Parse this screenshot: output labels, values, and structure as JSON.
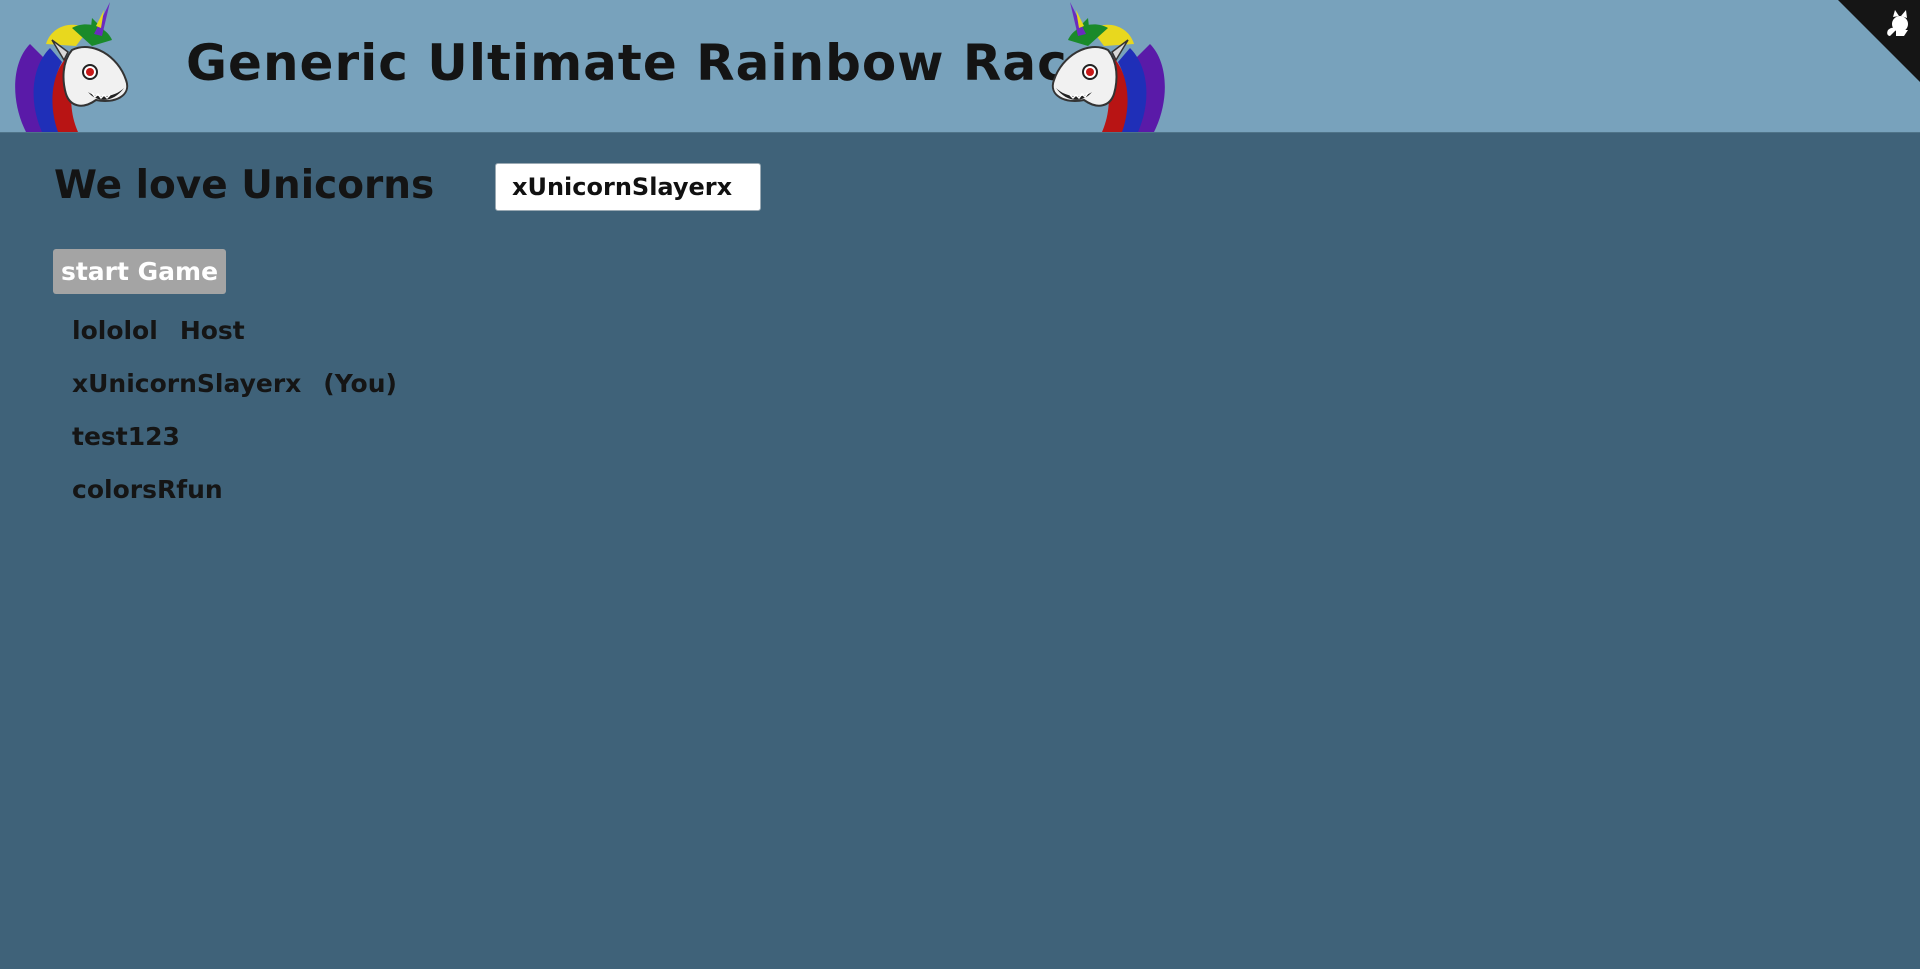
{
  "header": {
    "title": "Generic Ultimate Rainbow Race",
    "logo_icon": "unicorn-icon",
    "corner_icon": "github-cat-icon"
  },
  "lobby": {
    "subtitle": "We love Unicorns",
    "name_input_value": "xUnicornSlayerx",
    "start_button_label": "start Game",
    "players": [
      {
        "name": "lololol",
        "tag": "Host"
      },
      {
        "name": "xUnicornSlayerx",
        "tag": "(You)"
      },
      {
        "name": "test123",
        "tag": ""
      },
      {
        "name": "colorsRfun",
        "tag": ""
      }
    ]
  },
  "colors": {
    "header_bg": "#78a2bc",
    "page_bg": "#3f6279",
    "button_bg": "#a4a4a4"
  }
}
